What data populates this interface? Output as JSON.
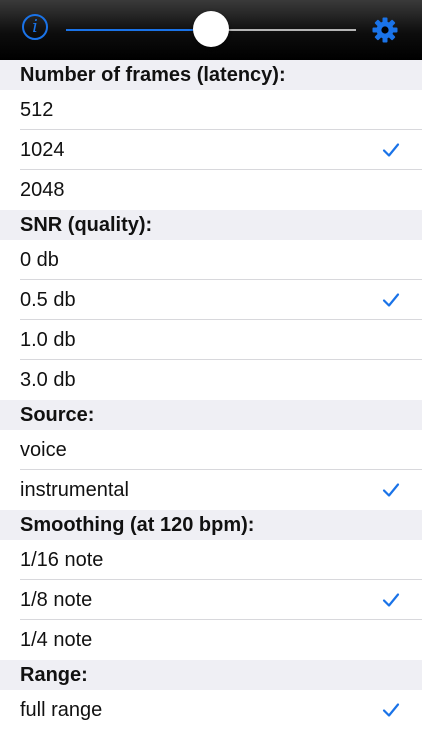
{
  "toolbar": {
    "info_icon": "info-icon",
    "info_glyph": "i",
    "settings_icon": "gear-icon",
    "slider_value_fraction": 0.5,
    "accent_color": "#1a73e8"
  },
  "sections": [
    {
      "header": "Number of frames (latency):",
      "options": [
        {
          "label": "512",
          "checked": false
        },
        {
          "label": "1024",
          "checked": true
        },
        {
          "label": "2048",
          "checked": false
        }
      ]
    },
    {
      "header": "SNR (quality):",
      "options": [
        {
          "label": "0 db",
          "checked": false
        },
        {
          "label": "0.5 db",
          "checked": true
        },
        {
          "label": "1.0 db",
          "checked": false
        },
        {
          "label": "3.0 db",
          "checked": false
        }
      ]
    },
    {
      "header": "Source:",
      "options": [
        {
          "label": "voice",
          "checked": false
        },
        {
          "label": "instrumental",
          "checked": true
        }
      ]
    },
    {
      "header": "Smoothing (at 120 bpm):",
      "options": [
        {
          "label": "1/16 note",
          "checked": false
        },
        {
          "label": "1/8 note",
          "checked": true
        },
        {
          "label": "1/4 note",
          "checked": false
        }
      ]
    },
    {
      "header": "Range:",
      "options": [
        {
          "label": "full range",
          "checked": true
        }
      ]
    }
  ]
}
